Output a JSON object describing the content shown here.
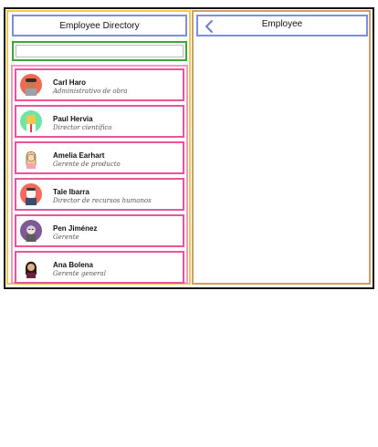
{
  "directory": {
    "title": "Employee Directory"
  },
  "search": {
    "placeholder": "",
    "value": ""
  },
  "employees": [
    {
      "name": "Carl Haro",
      "title": "Administrativo de obra"
    },
    {
      "name": "Paul Hervia",
      "title": "Director científico"
    },
    {
      "name": "Amelia Earhart",
      "title": "Gerente de producto"
    },
    {
      "name": "Tale Ibarra",
      "title": "Director de recursos humanos"
    },
    {
      "name": "Pen Jiménez",
      "title": "Gerente"
    },
    {
      "name": "Ana Bolena",
      "title": "Gerente general"
    }
  ],
  "detail": {
    "title": "Employee"
  },
  "icons": {
    "back": "chevron-left-icon"
  },
  "colors": {
    "directory_header": "#7b8ee0",
    "search_border": "#39a83a",
    "list_border": "#f29ac2",
    "item_border": "#e7559b",
    "left_pane": "#f2c94c",
    "right_pane": "#c9a36a"
  }
}
